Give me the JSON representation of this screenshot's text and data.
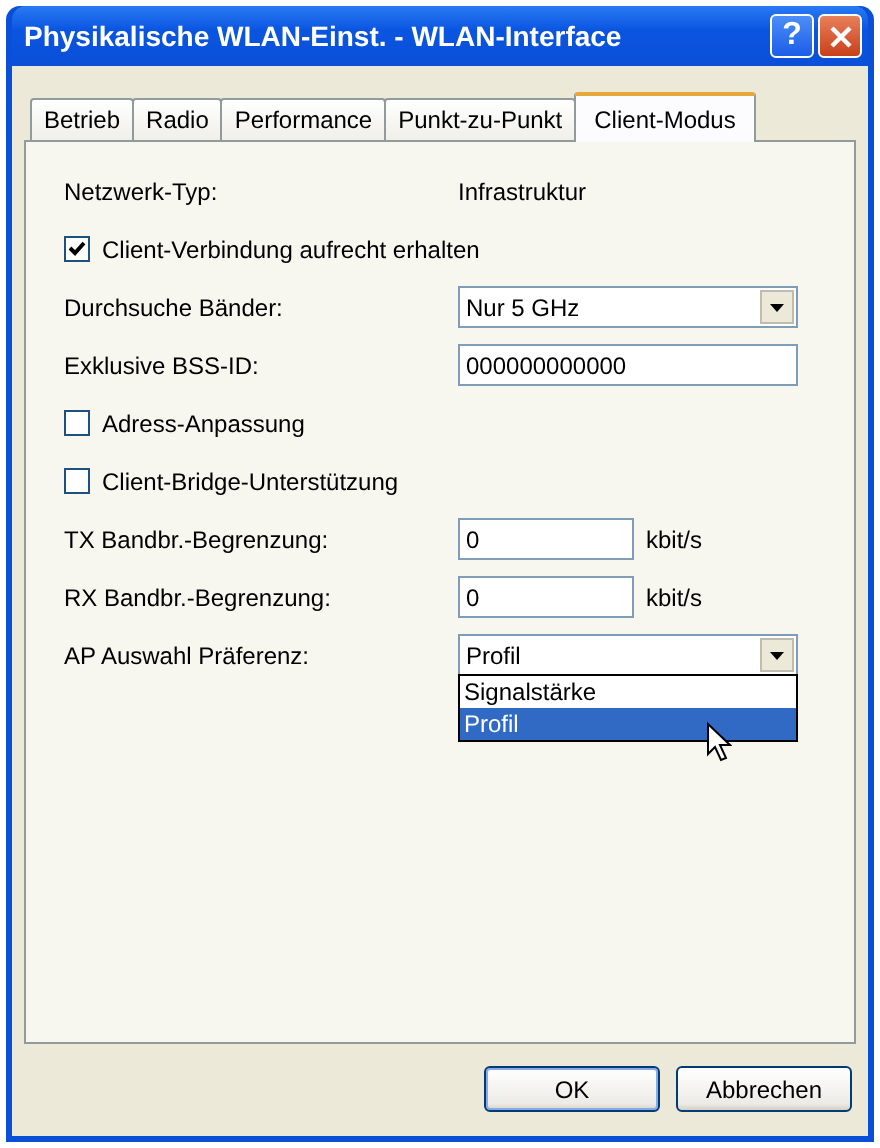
{
  "window": {
    "title": "Physikalische WLAN-Einst. - WLAN-Interface",
    "help_button": "?"
  },
  "tabs": [
    {
      "label": "Betrieb",
      "selected": false
    },
    {
      "label": "Radio",
      "selected": false
    },
    {
      "label": "Performance",
      "selected": false
    },
    {
      "label": "Punkt-zu-Punkt",
      "selected": false
    },
    {
      "label": "Client-Modus",
      "selected": true
    }
  ],
  "settings": [
    {
      "kind": "static",
      "label": "Netzwerk-Typ:",
      "value": "Infrastruktur"
    },
    {
      "kind": "checkbox",
      "label": "Client-Verbindung aufrecht erhalten",
      "checked": true
    },
    {
      "kind": "dropdown",
      "label": "Durchsuche Bänder:",
      "value": "Nur 5 GHz",
      "expanded": false
    },
    {
      "kind": "text",
      "label": "Exklusive BSS-ID:",
      "value": "000000000000"
    },
    {
      "kind": "checkbox",
      "label": "Adress-Anpassung",
      "checked": false
    },
    {
      "kind": "checkbox",
      "label": "Client-Bridge-Unterstützung",
      "checked": false
    },
    {
      "kind": "number",
      "label": "TX Bandbr.-Begrenzung:",
      "value": "0",
      "unit": "kbit/s"
    },
    {
      "kind": "number",
      "label": "RX Bandbr.-Begrenzung:",
      "value": "0",
      "unit": "kbit/s"
    },
    {
      "kind": "dropdown",
      "label": "AP Auswahl Präferenz:",
      "value": "Profil",
      "expanded": true,
      "options": [
        {
          "label": "Signalstärke",
          "selected": false
        },
        {
          "label": "Profil",
          "selected": true
        }
      ]
    }
  ],
  "buttons": [
    {
      "label": "OK",
      "default": true
    },
    {
      "label": "Abbrechen",
      "default": false
    }
  ]
}
